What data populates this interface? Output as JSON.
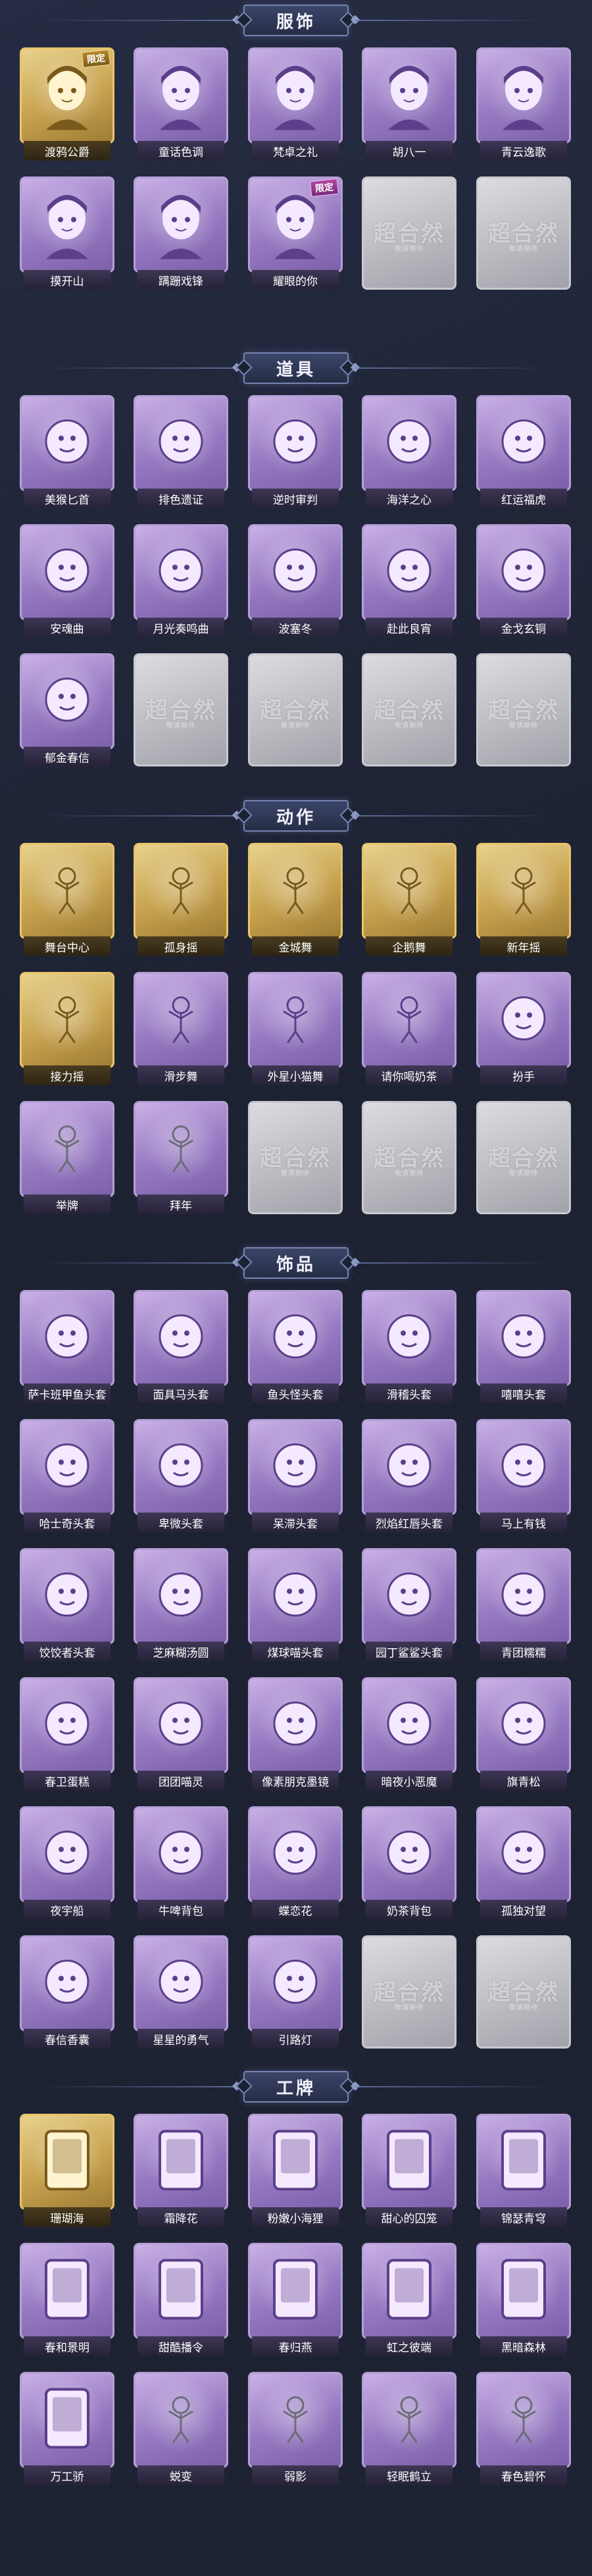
{
  "sections": [
    {
      "title": "服饰",
      "items": [
        {
          "label": "渡鸦公爵",
          "tag": "限定",
          "style": "gold",
          "icon": "character-portrait-icon"
        },
        {
          "label": "童话色调",
          "tag": "",
          "style": "purple",
          "icon": "character-portrait-icon"
        },
        {
          "label": "梵卓之礼",
          "tag": "",
          "style": "purple",
          "icon": "character-portrait-icon"
        },
        {
          "label": "胡八一",
          "tag": "",
          "style": "purple",
          "icon": "character-portrait-icon"
        },
        {
          "label": "青云逸歌",
          "tag": "",
          "style": "purple",
          "icon": "character-portrait-icon"
        },
        {
          "label": "摸开山",
          "tag": "",
          "style": "purple",
          "icon": "character-portrait-icon"
        },
        {
          "label": "蹒跚戏锋",
          "tag": "",
          "style": "purple",
          "icon": "character-portrait-icon"
        },
        {
          "label": "耀眼的你",
          "tag": "限定",
          "style": "purple",
          "icon": "character-portrait-icon"
        },
        {
          "label": "",
          "tag": "",
          "style": "empty",
          "icon": ""
        },
        {
          "label": "",
          "tag": "",
          "style": "empty",
          "icon": ""
        }
      ]
    },
    {
      "title": "道具",
      "items": [
        {
          "label": "美猴匕首",
          "style": "purple",
          "icon": "dagger-icon"
        },
        {
          "label": "排色遗证",
          "style": "purple",
          "icon": "staff-icon"
        },
        {
          "label": "逆时审判",
          "style": "purple",
          "icon": "pocket-watch-icon"
        },
        {
          "label": "海洋之心",
          "style": "purple",
          "icon": "pendant-icon"
        },
        {
          "label": "红运福虎",
          "style": "purple",
          "icon": "tiger-lantern-icon"
        },
        {
          "label": "安魂曲",
          "style": "purple",
          "icon": "gun-icon"
        },
        {
          "label": "月光奏鸣曲",
          "style": "purple",
          "icon": "piano-icon"
        },
        {
          "label": "波塞冬",
          "style": "purple",
          "icon": "trident-icon"
        },
        {
          "label": "赴此良宵",
          "style": "purple",
          "icon": "fan-ornament-icon"
        },
        {
          "label": "金戈玄铜",
          "style": "purple",
          "icon": "bronze-vessel-icon"
        },
        {
          "label": "郁金春信",
          "style": "purple",
          "icon": "fan-icon"
        },
        {
          "label": "",
          "style": "empty",
          "icon": ""
        },
        {
          "label": "",
          "style": "empty",
          "icon": ""
        },
        {
          "label": "",
          "style": "empty",
          "icon": ""
        },
        {
          "label": "",
          "style": "empty",
          "icon": ""
        }
      ]
    },
    {
      "title": "动作",
      "items": [
        {
          "label": "舞台中心",
          "style": "gold",
          "icon": "pose-figure-icon"
        },
        {
          "label": "孤身摇",
          "style": "gold",
          "icon": "pose-figure-icon"
        },
        {
          "label": "金城舞",
          "style": "gold",
          "icon": "pose-figure-icon"
        },
        {
          "label": "企鹅舞",
          "style": "gold",
          "icon": "pose-figure-icon"
        },
        {
          "label": "新年摇",
          "style": "gold",
          "icon": "pose-figure-icon"
        },
        {
          "label": "接力摇",
          "style": "gold",
          "icon": "pose-figure-icon"
        },
        {
          "label": "滑步舞",
          "style": "purple",
          "icon": "pose-figure-icon"
        },
        {
          "label": "外星小猫舞",
          "style": "purple",
          "icon": "pose-figure-icon"
        },
        {
          "label": "请你喝奶茶",
          "style": "purple",
          "icon": "pose-figure-icon"
        },
        {
          "label": "扮手",
          "style": "purple",
          "icon": "hand-gesture-icon"
        },
        {
          "label": "举牌",
          "style": "gray",
          "icon": "sign-figure-icon"
        },
        {
          "label": "拜年",
          "style": "gray",
          "icon": "pose-figure-icon"
        },
        {
          "label": "",
          "style": "empty",
          "icon": ""
        },
        {
          "label": "",
          "style": "empty",
          "icon": ""
        },
        {
          "label": "",
          "style": "empty",
          "icon": ""
        }
      ]
    },
    {
      "title": "饰品",
      "items": [
        {
          "label": "萨卡班甲鱼头套",
          "style": "purple",
          "icon": "fish-head-icon"
        },
        {
          "label": "面具马头套",
          "style": "purple",
          "icon": "horse-head-icon"
        },
        {
          "label": "鱼头怪头套",
          "style": "purple",
          "icon": "frog-head-icon"
        },
        {
          "label": "滑稽头套",
          "style": "purple",
          "icon": "funny-face-icon"
        },
        {
          "label": "嘻嘻头套",
          "style": "purple",
          "icon": "grin-face-icon"
        },
        {
          "label": "哈士奇头套",
          "style": "purple",
          "icon": "husky-head-icon"
        },
        {
          "label": "卑微头套",
          "style": "purple",
          "icon": "humble-face-icon"
        },
        {
          "label": "呆滞头套",
          "style": "purple",
          "icon": "dazed-face-icon"
        },
        {
          "label": "烈焰红唇头套",
          "style": "purple",
          "icon": "lips-head-icon"
        },
        {
          "label": "马上有钱",
          "style": "purple",
          "icon": "pink-horse-icon"
        },
        {
          "label": "饺饺者头套",
          "style": "purple",
          "icon": "dumpling-head-icon"
        },
        {
          "label": "芝麻糊汤圆",
          "style": "purple",
          "icon": "rice-ball-icon"
        },
        {
          "label": "煤球喵头套",
          "style": "purple",
          "icon": "cat-head-icon"
        },
        {
          "label": "园丁鲨鲨头套",
          "style": "purple",
          "icon": "shark-head-icon"
        },
        {
          "label": "青团糯糯",
          "style": "purple",
          "icon": "green-dumpling-icon"
        },
        {
          "label": "春卫蛋糕",
          "style": "purple",
          "icon": "cake-icon"
        },
        {
          "label": "团团喵灵",
          "style": "purple",
          "icon": "cat-spirit-icon"
        },
        {
          "label": "像素朋克墨镜",
          "style": "purple",
          "icon": "pixel-glasses-icon"
        },
        {
          "label": "暗夜小恶魔",
          "style": "purple",
          "icon": "devil-horns-icon"
        },
        {
          "label": "旗青松",
          "style": "purple",
          "icon": "bonsai-icon"
        },
        {
          "label": "夜宇船",
          "style": "purple",
          "icon": "ship-ornament-icon"
        },
        {
          "label": "牛啤背包",
          "style": "purple",
          "icon": "beer-backpack-icon"
        },
        {
          "label": "蝶恋花",
          "style": "purple",
          "icon": "butterfly-icon"
        },
        {
          "label": "奶茶背包",
          "style": "purple",
          "icon": "milk-tea-backpack-icon"
        },
        {
          "label": "孤独对望",
          "style": "purple",
          "icon": "statue-icon"
        },
        {
          "label": "春信香囊",
          "style": "purple",
          "icon": "sachet-icon"
        },
        {
          "label": "星星的勇气",
          "style": "purple",
          "icon": "star-bouquet-icon"
        },
        {
          "label": "引路灯",
          "style": "purple",
          "icon": "lantern-icon"
        },
        {
          "label": "",
          "style": "empty",
          "icon": ""
        },
        {
          "label": "",
          "style": "empty",
          "icon": ""
        }
      ]
    },
    {
      "title": "工牌",
      "items": [
        {
          "label": "珊瑚海",
          "style": "gold",
          "icon": "badge-card-icon"
        },
        {
          "label": "霜降花",
          "style": "purple",
          "icon": "badge-card-icon"
        },
        {
          "label": "粉嫩小海狸",
          "style": "purple",
          "icon": "badge-card-icon"
        },
        {
          "label": "甜心的囚笼",
          "style": "purple",
          "icon": "badge-card-icon"
        },
        {
          "label": "锦瑟青穹",
          "style": "purple",
          "icon": "badge-card-icon"
        },
        {
          "label": "春和景明",
          "style": "purple",
          "icon": "badge-card-icon"
        },
        {
          "label": "甜酷播令",
          "style": "purple",
          "icon": "badge-card-icon"
        },
        {
          "label": "春归燕",
          "style": "purple",
          "icon": "badge-card-icon"
        },
        {
          "label": "虹之彼端",
          "style": "purple",
          "icon": "badge-card-icon"
        },
        {
          "label": "黑暗森林",
          "style": "purple",
          "icon": "badge-card-icon"
        },
        {
          "label": "万工骄",
          "style": "purple",
          "icon": "badge-card-icon"
        },
        {
          "label": "蜕变",
          "style": "gray",
          "icon": "silhouette-icon"
        },
        {
          "label": "弱影",
          "style": "gray",
          "icon": "silhouette-icon"
        },
        {
          "label": "轻眠鹤立",
          "style": "gray",
          "icon": "silhouette-icon"
        },
        {
          "label": "春色碧怀",
          "style": "gray",
          "icon": "silhouette-icon"
        }
      ]
    }
  ],
  "placeholder": {
    "title": "超合然",
    "subtitle": "敬请期待"
  },
  "colors": {
    "background": "#1d2233",
    "purple_frame": "#b59fd6",
    "gold_frame": "#e8c56a",
    "gray_frame": "#c9c9cf"
  }
}
